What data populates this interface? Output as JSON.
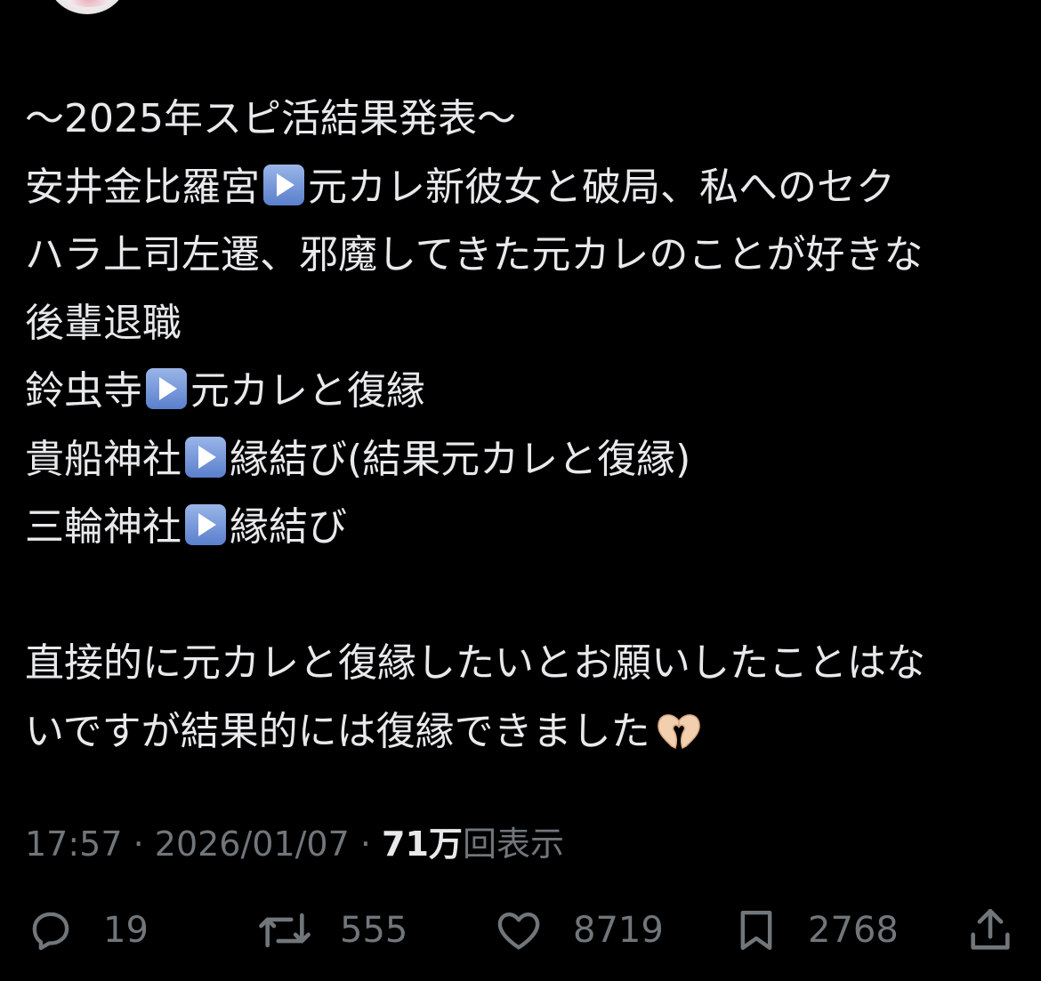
{
  "tweet": {
    "lines": [
      "〜2025年スピ活結果発表〜",
      [
        "安井金比羅宮",
        "元カレ新彼女と破局、私へのセク"
      ],
      "ハラ上司左遷、邪魔してきた元カレのことが好きな",
      "後輩退職",
      [
        "鈴虫寺",
        "元カレと復縁"
      ],
      [
        "貴船神社",
        "縁結び(結果元カレと復縁)"
      ],
      [
        "三輪神社",
        "縁結び"
      ],
      "",
      "直接的に元カレと復縁したいとお願いしたことはな",
      "いですが結果的には復縁できました"
    ]
  },
  "l0": "〜2025年スピ活結果発表〜",
  "l1a": "安井金比羅宮",
  "l1b": "元カレ新彼女と破局、私へのセク",
  "l2": "ハラ上司左遷、邪魔してきた元カレのことが好きな",
  "l3": "後輩退職",
  "l4a": "鈴虫寺",
  "l4b": "元カレと復縁",
  "l5a": "貴船神社",
  "l5b": "縁結び(結果元カレと復縁)",
  "l6a": "三輪神社",
  "l6b": "縁結び",
  "l8": "直接的に元カレと復縁したいとお願いしたことはな",
  "l9": "いですが結果的には復縁できました",
  "emoji": {
    "play": "play-button-emoji",
    "heart_hands": "heart-hands-emoji"
  },
  "meta": {
    "time": "17:57",
    "sep": " · ",
    "date": "2026/01/07",
    "views_count": "71万",
    "views_label": "回表示"
  },
  "actions": {
    "reply": "19",
    "repost": "555",
    "like": "8719",
    "bookmark": "2768"
  },
  "colors": {
    "background": "#000000",
    "text": "#e7e9ea",
    "muted": "#71767b"
  }
}
